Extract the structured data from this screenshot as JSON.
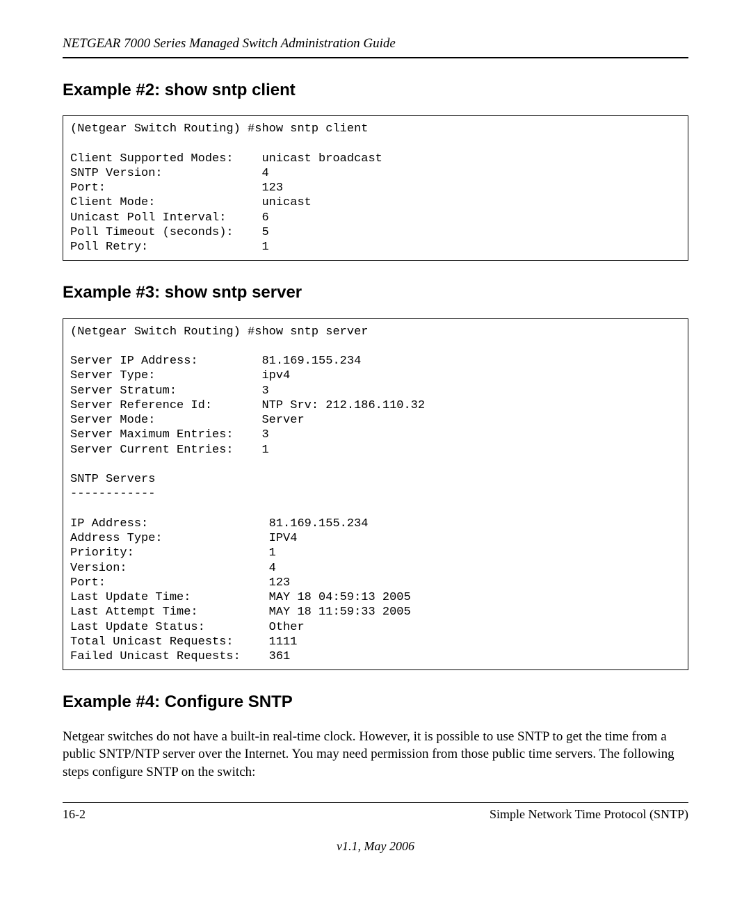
{
  "doc_title": "NETGEAR 7000  Series Managed Switch Administration Guide",
  "example2": {
    "heading": "Example #2: show sntp client",
    "code": "(Netgear Switch Routing) #show sntp client\n\nClient Supported Modes:    unicast broadcast\nSNTP Version:              4\nPort:                      123\nClient Mode:               unicast\nUnicast Poll Interval:     6\nPoll Timeout (seconds):    5\nPoll Retry:                1"
  },
  "example3": {
    "heading": "Example #3: show sntp server",
    "code": "(Netgear Switch Routing) #show sntp server\n\nServer IP Address:         81.169.155.234\nServer Type:               ipv4\nServer Stratum:            3\nServer Reference Id:       NTP Srv: 212.186.110.32\nServer Mode:               Server\nServer Maximum Entries:    3\nServer Current Entries:    1\n\nSNTP Servers\n------------\n\nIP Address:                 81.169.155.234\nAddress Type:               IPV4\nPriority:                   1\nVersion:                    4\nPort:                       123\nLast Update Time:           MAY 18 04:59:13 2005\nLast Attempt Time:          MAY 18 11:59:33 2005\nLast Update Status:         Other\nTotal Unicast Requests:     1111\nFailed Unicast Requests:    361"
  },
  "example4": {
    "heading": "Example #4: Configure SNTP",
    "text": "Netgear switches do not have a built-in real-time clock. However, it is possible to use SNTP to get the time from a public SNTP/NTP server over the Internet. You may need permission from those public time servers. The following steps configure SNTP on the switch:"
  },
  "footer": {
    "page": "16-2",
    "section": "Simple Network Time Protocol (SNTP)",
    "version": "v1.1, May 2006"
  }
}
